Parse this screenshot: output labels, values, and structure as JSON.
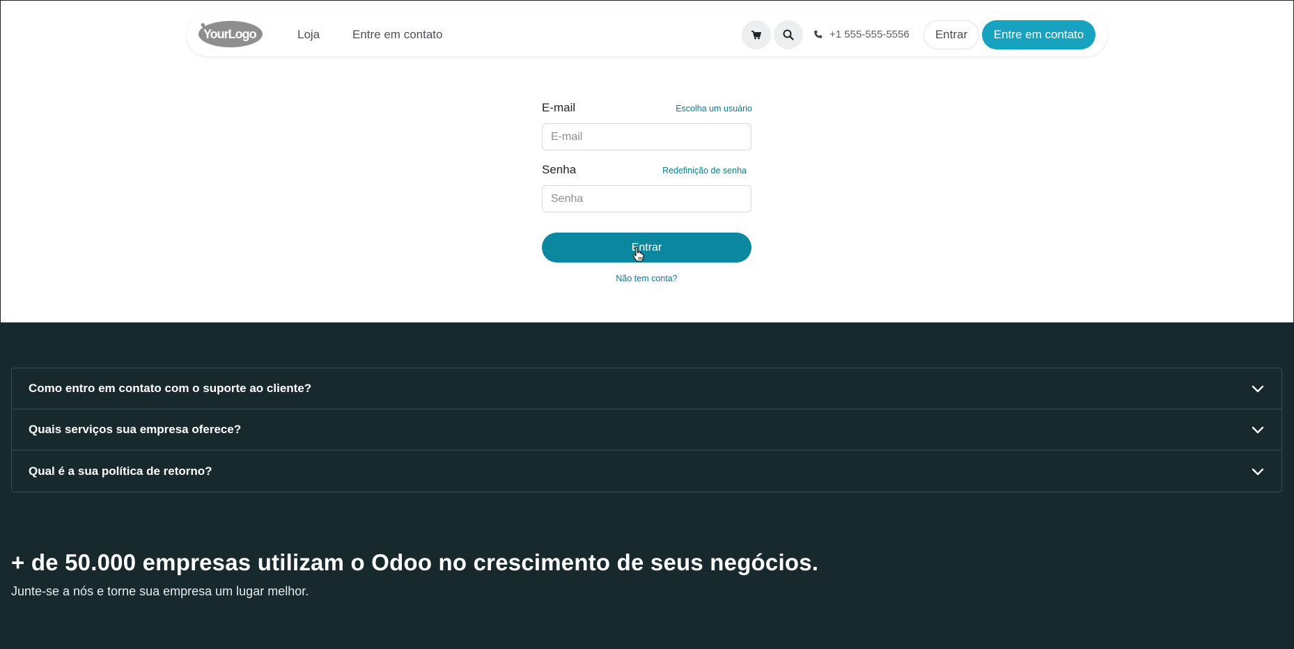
{
  "header": {
    "logo_text": "YourLogo",
    "nav": [
      {
        "label": "Loja"
      },
      {
        "label": "Entre em contato"
      }
    ],
    "phone": "+1 555-555-5556",
    "signin_label": "Entrar",
    "contact_label": "Entre em contato",
    "accent_color": "#17a2c0"
  },
  "login": {
    "email_label": "E-mail",
    "choose_user_link": "Escolha um usuário",
    "email_placeholder": "E-mail",
    "password_label": "Senha",
    "reset_password_link": "Redefinição de senha",
    "password_placeholder": "Senha",
    "submit_label": "Entrar",
    "no_account_link": "Não tem conta?",
    "button_color": "#0b87a0"
  },
  "faq": {
    "items": [
      {
        "question": "Como entro em contato com o suporte ao cliente?"
      },
      {
        "question": "Quais serviços sua empresa oferece?"
      },
      {
        "question": "Qual é a sua política de retorno?"
      }
    ]
  },
  "cta": {
    "headline": "+ de 50.000 empresas utilizam o Odoo no crescimento de seus negócios.",
    "subtext": "Junte-se a nós e torne sua empresa um lugar melhor.",
    "background_color": "#18292e"
  },
  "icons": {
    "cart": "cart-icon",
    "search": "search-icon",
    "phone": "phone-icon",
    "chevron": "chevron-down-icon",
    "cursor": "hand-pointer-icon"
  }
}
